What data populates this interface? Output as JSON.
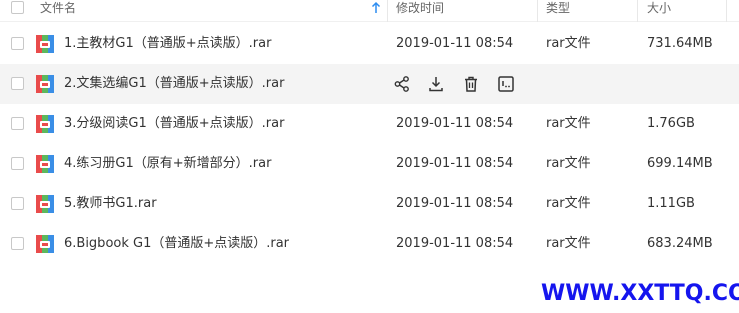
{
  "header": {
    "name_label": "文件名",
    "modified_label": "修改时间",
    "type_label": "类型",
    "size_label": "大小",
    "sort_icon": "arrow-up-icon"
  },
  "files": [
    {
      "name": "1.主教材G1（普通版+点读版）.rar",
      "date": "2019-01-11 08:54",
      "type": "rar文件",
      "size": "731.64MB"
    },
    {
      "name": "2.文集选编G1（普通版+点读版）.rar",
      "date": "",
      "type": "",
      "size": ""
    },
    {
      "name": "3.分级阅读G1（普通版+点读版）.rar",
      "date": "2019-01-11 08:54",
      "type": "rar文件",
      "size": "1.76GB"
    },
    {
      "name": "4.练习册G1（原有+新增部分）.rar",
      "date": "2019-01-11 08:54",
      "type": "rar文件",
      "size": "699.14MB"
    },
    {
      "name": "5.教师书G1.rar",
      "date": "2019-01-11 08:54",
      "type": "rar文件",
      "size": "1.11GB"
    },
    {
      "name": "6.Bigbook G1（普通版+点读版）.rar",
      "date": "2019-01-11 08:54",
      "type": "rar文件",
      "size": "683.24MB"
    }
  ],
  "row_actions": [
    "share-icon",
    "download-icon",
    "delete-icon",
    "more-icon"
  ],
  "watermark": "WWW.XXTTQ.COM",
  "colors": {
    "watermark": "#1515ee",
    "hover_row": "#f4f4f4",
    "sort_arrow": "#2c8cf0"
  }
}
